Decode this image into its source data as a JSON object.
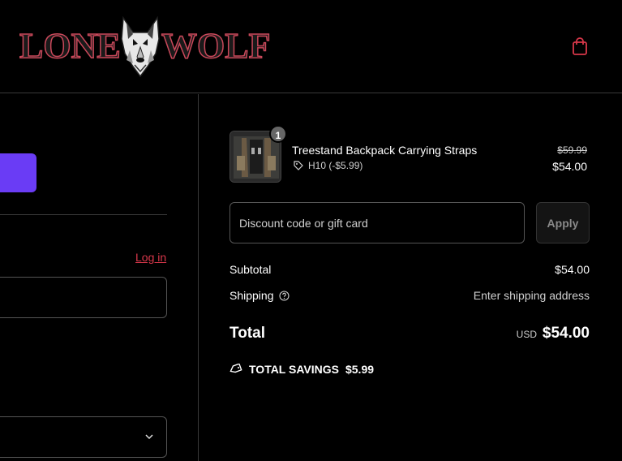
{
  "header": {
    "logo_left": "LONE",
    "logo_right": "WOLF",
    "cart_icon": "shopping-bag-icon"
  },
  "contact": {
    "login_label": "Log in"
  },
  "order": {
    "item": {
      "quantity": "1",
      "name": "Treestand Backpack Carrying Straps",
      "discount_code": "H10 (-$5.99)",
      "original_price": "$59.99",
      "price": "$54.00"
    },
    "discount": {
      "placeholder": "Discount code or gift card",
      "apply_label": "Apply"
    },
    "subtotal_label": "Subtotal",
    "subtotal_value": "$54.00",
    "shipping_label": "Shipping",
    "shipping_value": "Enter shipping address",
    "total_label": "Total",
    "total_currency": "USD",
    "total_value": "$54.00",
    "savings_label": "TOTAL SAVINGS",
    "savings_value": "$5.99"
  },
  "colors": {
    "accent": "#6a3cf5",
    "link": "#d8374a",
    "background": "#000000"
  }
}
